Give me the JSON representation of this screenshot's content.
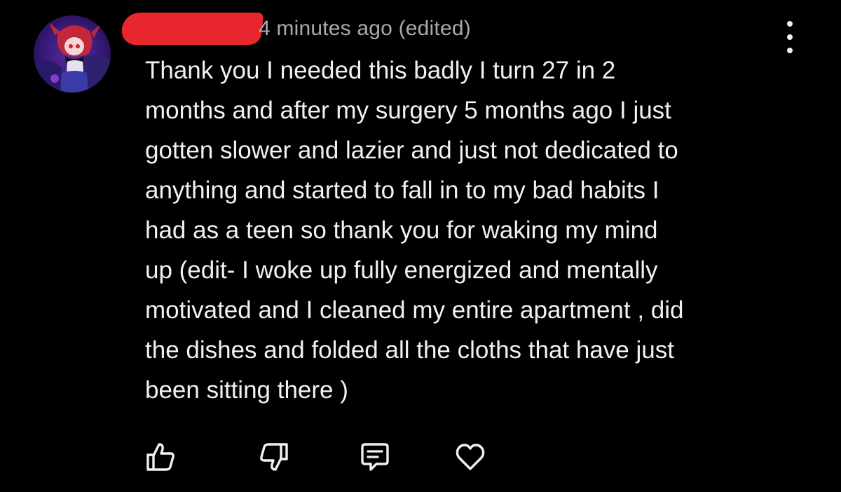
{
  "comment": {
    "author_redacted": true,
    "timestamp": "4 minutes ago (edited)",
    "text_lines": [
      "Thank you I needed this badly I turn 27 in 2",
      "months and after my surgery 5 months ago I just",
      "gotten slower and lazier and just not dedicated to",
      "anything and started to fall in to my bad habits I",
      "had as a teen so thank you for waking my mind",
      "up (edit- I woke up fully energized and mentally",
      "motivated and I cleaned my entire apartment , did",
      "the dishes and folded all the cloths that have just",
      "been sitting there )"
    ]
  },
  "actions": {
    "like_icon": "thumbs-up-icon",
    "dislike_icon": "thumbs-down-icon",
    "reply_icon": "comment-icon",
    "heart_icon": "heart-icon"
  },
  "colors": {
    "background": "#000000",
    "text": "#f1f1f1",
    "muted": "#aaaaaa",
    "redaction": "#e8262d"
  }
}
